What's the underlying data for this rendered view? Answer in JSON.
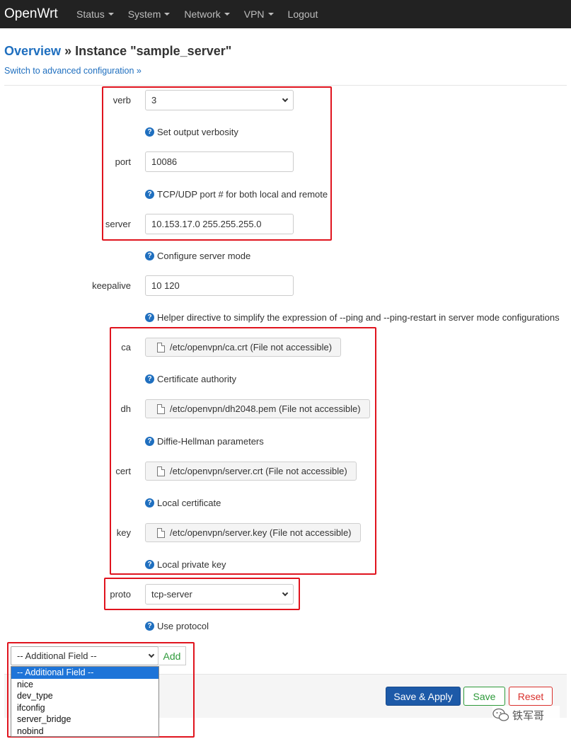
{
  "navbar": {
    "brand": "OpenWrt",
    "menu": [
      {
        "label": "Status",
        "has_caret": true
      },
      {
        "label": "System",
        "has_caret": true
      },
      {
        "label": "Network",
        "has_caret": true
      },
      {
        "label": "VPN",
        "has_caret": true
      },
      {
        "label": "Logout",
        "has_caret": false
      }
    ]
  },
  "header": {
    "breadcrumb_link": "Overview",
    "breadcrumb_rest": " » Instance \"sample_server\"",
    "advanced_link": "Switch to advanced configuration »"
  },
  "fields": {
    "verb": {
      "label": "verb",
      "value": "3",
      "help": "Set output verbosity"
    },
    "port": {
      "label": "port",
      "value": "10086",
      "help": "TCP/UDP port # for both local and remote"
    },
    "server": {
      "label": "server",
      "value": "10.153.17.0 255.255.255.0",
      "help": "Configure server mode"
    },
    "keepalive": {
      "label": "keepalive",
      "value": "10 120",
      "help": "Helper directive to simplify the expression of --ping and --ping-restart in server mode configurations"
    },
    "ca": {
      "label": "ca",
      "value": "/etc/openvpn/ca.crt (File not accessible)",
      "help": "Certificate authority"
    },
    "dh": {
      "label": "dh",
      "value": "/etc/openvpn/dh2048.pem (File not accessible)",
      "help": "Diffie-Hellman parameters"
    },
    "cert": {
      "label": "cert",
      "value": "/etc/openvpn/server.crt (File not accessible)",
      "help": "Local certificate"
    },
    "key": {
      "label": "key",
      "value": "/etc/openvpn/server.key (File not accessible)",
      "help": "Local private key"
    },
    "proto": {
      "label": "proto",
      "value": "tcp-server",
      "help": "Use protocol"
    }
  },
  "additional": {
    "selected": "-- Additional Field --",
    "add_label": "Add",
    "options": [
      "-- Additional Field --",
      "nice",
      "dev_type",
      "ifconfig",
      "server_bridge",
      "nobind"
    ]
  },
  "actions": {
    "save_apply": "Save & Apply",
    "save": "Save",
    "reset": "Reset"
  },
  "watermark": "铁军哥",
  "colors": {
    "navbar_bg": "#222222",
    "link": "#1f6fbf",
    "annotation_red": "#e0141e",
    "primary_button": "#1d5aa8",
    "save_green": "#2e9a3a",
    "reset_red": "#d9302c"
  }
}
